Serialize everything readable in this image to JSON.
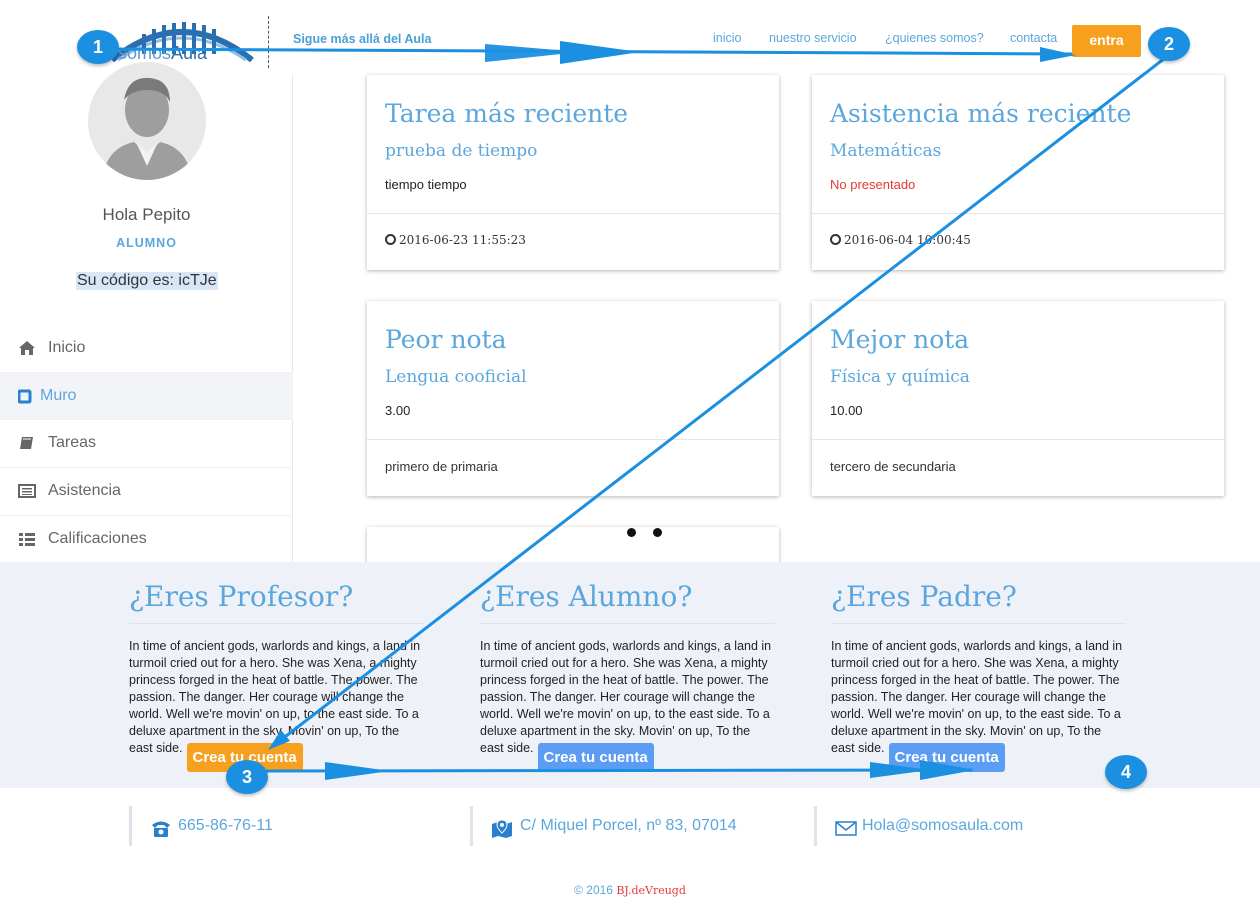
{
  "brand": {
    "logo_part1": "somos",
    "logo_part2": "Aula",
    "tagline": "Sigue más allá del Aula"
  },
  "nav": {
    "items": [
      "inicio",
      "nuestro servicio",
      "¿quienes somos?",
      "contacta"
    ],
    "cta": "entra"
  },
  "sidebar": {
    "greeting": "Hola Pepito",
    "role": "ALUMNO",
    "code": "Su código es: icTJe",
    "menu": [
      "Inicio",
      "Muro",
      "Tareas",
      "Asistencia",
      "Calificaciones"
    ]
  },
  "cards": [
    {
      "title": "Tarea más reciente",
      "subtitle": "prueba de tiempo",
      "body": "tiempo tiempo",
      "footer": "2016-06-23 11:55:23"
    },
    {
      "title": "Asistencia más reciente",
      "subtitle": "Matemáticas",
      "body": "No presentado",
      "footer": "2016-06-04 10:00:45"
    },
    {
      "title": "Peor nota",
      "subtitle": "Lengua cooficial",
      "body": "3.00",
      "footer": "primero de primaria"
    },
    {
      "title": "Mejor nota",
      "subtitle": "Física y química",
      "body": "10.00",
      "footer": "tercero de secundaria"
    }
  ],
  "roles": [
    {
      "title": "¿Eres Profesor?",
      "text": "In time of ancient gods, warlords and kings, a land in turmoil cried out for a hero. She was Xena, a mighty princess forged in the heat of battle. The power. The passion. The danger. Her courage will change the world. Well we're movin' on up, to the east side. To a deluxe apartment in the sky. Movin' on up, To the east side.",
      "button": "Crea tu cuenta"
    },
    {
      "title": "¿Eres Alumno?",
      "text": "In time of ancient gods, warlords and kings, a land in turmoil cried out for a hero. She was Xena, a mighty princess forged in the heat of battle. The power. The passion. The danger. Her courage will change the world. Well we're movin' on up, to the east side. To a deluxe apartment in the sky. Movin' on up, To the east side.",
      "button": "Crea tu cuenta"
    },
    {
      "title": "¿Eres Padre?",
      "text": "In time of ancient gods, warlords and kings, a land in turmoil cried out for a hero. She was Xena, a mighty princess forged in the heat of battle. The power. The passion. The danger. Her courage will change the world. Well we're movin' on up, to the east side. To a deluxe apartment in the sky. Movin' on up, To the east side.",
      "button": "Crea tu cuenta"
    }
  ],
  "contact": {
    "phone": "665-86-76-11",
    "address": "C/ Miquel Porcel, nº 83, 07014",
    "email": "Hola@somosaula.com"
  },
  "footer": {
    "copyright": "© 2016",
    "author": "BJ.deVreugd"
  },
  "annotations": [
    "1",
    "2",
    "3",
    "4"
  ],
  "colors": {
    "accent_blue": "#5ba7dd",
    "cta_orange": "#f7a01e",
    "button_blue": "#5b9df5",
    "alert_red": "#e53935",
    "annotation_blue": "#1b8fe0"
  }
}
